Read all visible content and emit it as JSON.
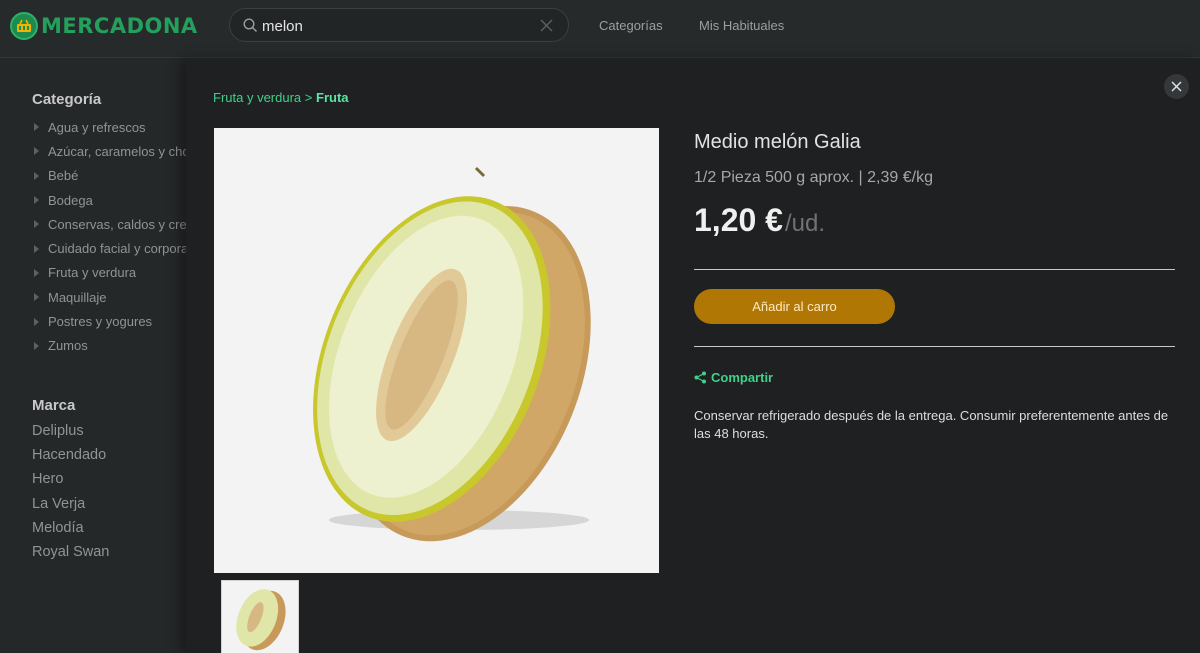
{
  "header": {
    "brand": "MERCADONA",
    "search": {
      "value": "melon"
    },
    "nav": [
      "Categorías",
      "Mis Habituales"
    ]
  },
  "sidebar": {
    "category_heading": "Categoría",
    "categories": [
      "Agua y refrescos",
      "Azúcar, caramelos y chocolate",
      "Bebé",
      "Bodega",
      "Conservas, caldos y cremas",
      "Cuidado facial y corporal",
      "Fruta y verdura",
      "Maquillaje",
      "Postres y yogures",
      "Zumos"
    ],
    "brand_heading": "Marca",
    "brands": [
      "Deliplus",
      "Hacendado",
      "Hero",
      "La Verja",
      "Melodía",
      "Royal Swan"
    ]
  },
  "product": {
    "breadcrumb": {
      "parent": "Fruta y verdura",
      "separator": ">",
      "current": "Fruta"
    },
    "title": "Medio melón Galia",
    "subtitle": "1/2 Pieza 500 g aprox. | 2,39 €/kg",
    "price": "1,20 €",
    "unit": "/ud.",
    "add_button": "Añadir al carro",
    "share": "Compartir",
    "description": "Conservar refrigerado después de la entrega. Consumir preferentemente antes de las 48 horas."
  },
  "colors": {
    "accent_green": "#3fd18a",
    "button_gold": "#b07705",
    "brand_green": "#23a15c"
  }
}
